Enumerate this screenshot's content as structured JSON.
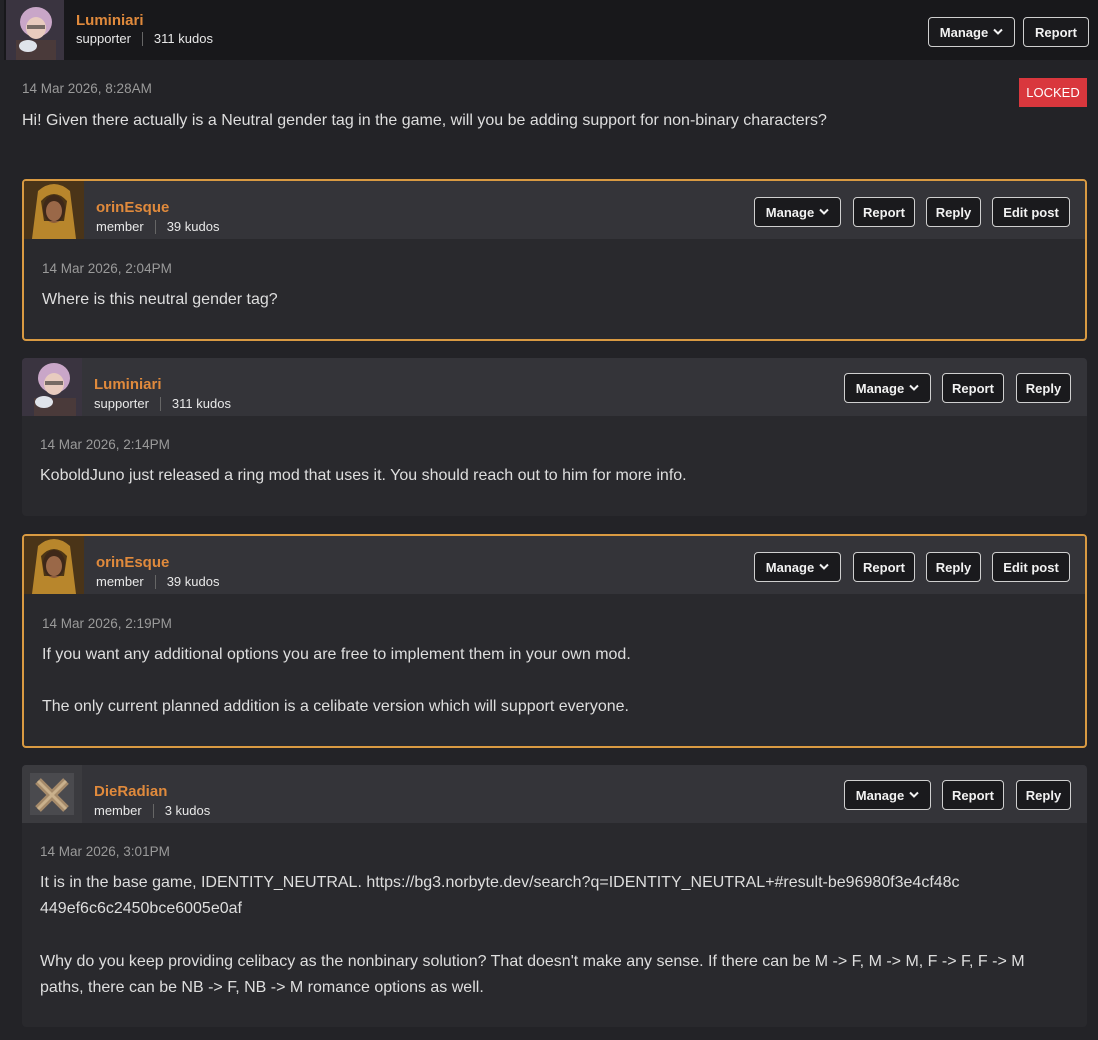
{
  "top_post": {
    "author": "Luminiari",
    "role": "supporter",
    "kudos": "311 kudos",
    "timestamp": "14 Mar 2026, 8:28AM",
    "badge": "LOCKED",
    "text": "Hi! Given there actually is a Neutral gender tag in the game, will you be adding support for non-binary characters?",
    "buttons": {
      "manage": "Manage",
      "report": "Report"
    }
  },
  "replies": [
    {
      "author": "orinEsque",
      "role": "member",
      "kudos": "39 kudos",
      "timestamp": "14 Mar 2026, 2:04PM",
      "paragraphs": [
        "Where is this neutral gender tag?"
      ],
      "buttons": {
        "manage": "Manage",
        "report": "Report",
        "reply": "Reply",
        "edit": "Edit post"
      }
    },
    {
      "author": "Luminiari",
      "role": "supporter",
      "kudos": "311 kudos",
      "timestamp": "14 Mar 2026, 2:14PM",
      "paragraphs": [
        "KoboldJuno just released a ring mod that uses it. You should reach out to him for more info."
      ],
      "buttons": {
        "manage": "Manage",
        "report": "Report",
        "reply": "Reply"
      }
    },
    {
      "author": "orinEsque",
      "role": "member",
      "kudos": "39 kudos",
      "timestamp": "14 Mar 2026, 2:19PM",
      "paragraphs": [
        "If you want any additional options you are free to implement them in your own mod.",
        "The only current planned addition is a celibate version which will support everyone."
      ],
      "buttons": {
        "manage": "Manage",
        "report": "Report",
        "reply": "Reply",
        "edit": "Edit post"
      }
    },
    {
      "author": "DieRadian",
      "role": "member",
      "kudos": "3 kudos",
      "timestamp": "14 Mar 2026, 3:01PM",
      "paragraphs": [
        "It is in the base game, IDENTITY_NEUTRAL. https://bg3.norbyte.dev/search?q=IDENTITY_NEUTRAL+#result-be96980f3e4cf48c449ef6c6c2450bce6005e0af",
        "Why do you keep providing celibacy as the nonbinary solution? That doesn't make any sense. If there can be M -> F, M -> M, F -> F, F -> M paths, there can be NB -> F, NB -> M romance options as well."
      ],
      "buttons": {
        "manage": "Manage",
        "report": "Report",
        "reply": "Reply"
      }
    }
  ],
  "colors": {
    "accent": "#e08a3c",
    "highlight_border": "#d99a42",
    "locked": "#d9373d"
  },
  "icons": [
    "avatar-luminiari",
    "avatar-orinesque",
    "avatar-dieradian",
    "chevron-down-icon"
  ]
}
